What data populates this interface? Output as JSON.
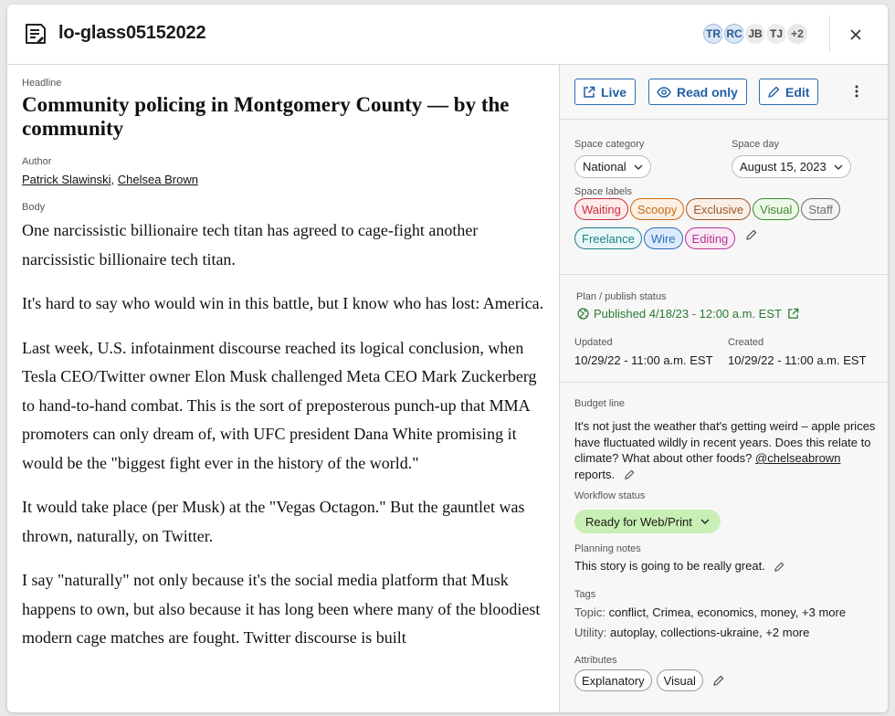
{
  "header": {
    "title": "lo-glass05152022",
    "avatars": [
      {
        "initials": "TR",
        "style": "blue"
      },
      {
        "initials": "RC",
        "style": "blue"
      },
      {
        "initials": "JB",
        "style": "gray"
      },
      {
        "initials": "TJ",
        "style": "gray"
      }
    ],
    "avatar_overflow": "+2"
  },
  "article": {
    "headline_label": "Headline",
    "headline": "Community policing in Montgomery County — by the community",
    "author_label": "Author",
    "authors": [
      "Patrick Slawinski",
      "Chelsea Brown"
    ],
    "author_separator": ",",
    "body_label": "Body",
    "paragraphs": [
      "One narcissistic billionaire tech titan has agreed to cage-fight another narcissistic billionaire tech titan.",
      "It's hard to say who would win in this battle, but I know who has lost: America.",
      "Last week, U.S. infotainment discourse reached its logical conclusion, when Tesla CEO/Twitter owner Elon Musk challenged Meta CEO Mark Zuckerberg to hand-to-hand combat. This is the sort of preposterous punch-up that MMA promoters can only dream of, with UFC president Dana White promising it would be the \"biggest fight ever in the history of the world.\"",
      "It would take place (per Musk) at the \"Vegas Octagon.\" But the gauntlet was thrown, naturally, on Twitter.",
      "I say \"naturally\" not only because it's the social media platform that Musk happens to own, but also because it has long been where many of the bloodiest modern cage matches are fought. Twitter discourse is built"
    ]
  },
  "sidebar": {
    "buttons": {
      "live": "Live",
      "read_only": "Read only",
      "edit": "Edit"
    },
    "space_category_label": "Space category",
    "space_category_value": "National",
    "space_day_label": "Space day",
    "space_day_value": "August 15, 2023",
    "space_labels_label": "Space labels",
    "space_labels": [
      {
        "text": "Waiting",
        "color": "#c9303e",
        "bg": "#fdeaea"
      },
      {
        "text": "Scoopy",
        "color": "#c76a14",
        "bg": "#fdf0e2"
      },
      {
        "text": "Exclusive",
        "color": "#9a5a2a",
        "bg": "#faefe6"
      },
      {
        "text": "Visual",
        "color": "#3f8a2e",
        "bg": "#eef8e8"
      },
      {
        "text": "Staff",
        "color": "#6e6e6e",
        "bg": "#f4f4f4"
      },
      {
        "text": "Freelance",
        "color": "#1f7f86",
        "bg": "#e8f6f7"
      },
      {
        "text": "Wire",
        "color": "#2f6cb7",
        "bg": "#dcebfb"
      },
      {
        "text": "Editing",
        "color": "#b43595",
        "bg": "#fbeaf6"
      }
    ],
    "plan_label": "Plan / publish status",
    "publish_status": "Published 4/18/23 - 12:00 a.m. EST",
    "updated_label": "Updated",
    "updated_value": "10/29/22 - 11:00 a.m. EST",
    "created_label": "Created",
    "created_value": "10/29/22 - 11:00 a.m. EST",
    "budget_label": "Budget line",
    "budget_text": "It's not just the weather that's getting weird – apple prices have fluctuated wildly in recent years. Does this relate to climate? What about other foods?",
    "budget_mention": "@chelseabrown",
    "budget_tail": "reports.",
    "workflow_label": "Workflow status",
    "workflow_value": "Ready for Web/Print",
    "planning_label": "Planning notes",
    "planning_value": "This story is going to be really great.",
    "tags_label": "Tags",
    "topic_key": "Topic:",
    "topic_values": "conflict, Crimea, economics, money, +3 more",
    "utility_key": "Utility:",
    "utility_values": "autoplay, collections-ukraine, +2 more",
    "attributes_label": "Attributes",
    "attributes": [
      "Explanatory",
      "Visual"
    ]
  },
  "colors": {
    "accent": "#1f5fa6",
    "publish_green": "#2a7a30",
    "workflow_bg": "#c8efb4"
  }
}
